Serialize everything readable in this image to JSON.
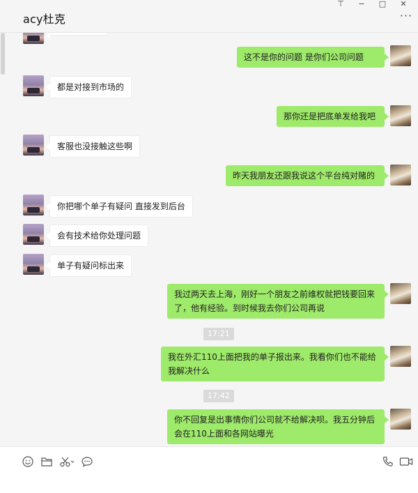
{
  "window": {
    "title": "acy杜克",
    "controls": {
      "pin": "⊤",
      "minimize": "−",
      "maximize": "□",
      "close": "✕"
    },
    "more": "···"
  },
  "messages": [
    {
      "side": "left",
      "text": "都是对接到市场的"
    },
    {
      "side": "right",
      "text": "这不是你的问题   是你们公司问题"
    },
    {
      "side": "right",
      "text": "那你还是把底单发给我吧"
    },
    {
      "side": "left",
      "text": "客服也没接触这些啊"
    },
    {
      "side": "right",
      "text": "昨天我朋友还跟我说这个平台纯对赌的"
    },
    {
      "side": "left",
      "text": "你把哪个单子有疑问  直接发到后台"
    },
    {
      "side": "left",
      "text": "会有技术给你处理问题"
    },
    {
      "side": "left",
      "text": "单子有疑问标出来"
    },
    {
      "side": "right",
      "text": "我过两天去上海，刚好一个朋友之前维权就把钱要回来了，他有经验。到时候我去你们公司再说"
    },
    {
      "side": "time",
      "text": "17:21"
    },
    {
      "side": "right",
      "text": "我在外汇110上面把我的单子报出来。我看你们也不能给我解决什么"
    },
    {
      "side": "time",
      "text": "17:42"
    },
    {
      "side": "right",
      "text": "你不回复是出事情你们公司就不给解决呗。我五分钟后会在110上面和各网站曝光"
    }
  ],
  "toolbar": {
    "emoji": "emoji-icon",
    "folder": "folder-icon",
    "scissors": "scissors-icon",
    "chat_history": "chat-history-icon",
    "voice_call": "phone-icon",
    "video_call": "video-icon"
  },
  "colors": {
    "bubble_self": "#9eea6a",
    "bubble_other": "#ffffff",
    "background": "#f5f5f5"
  }
}
